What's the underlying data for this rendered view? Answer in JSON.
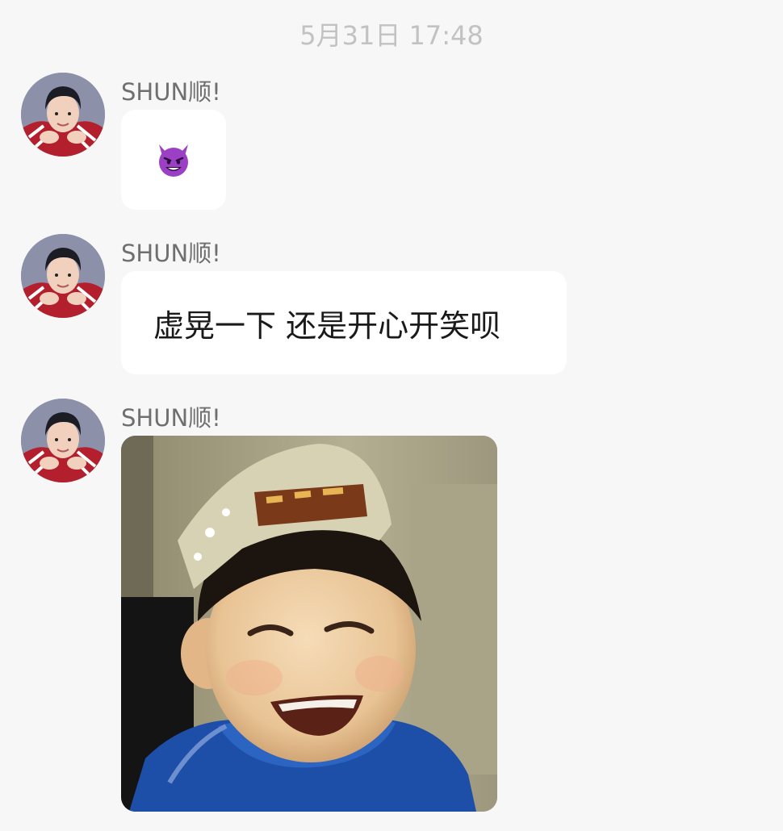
{
  "chat": {
    "timestamp": "5月31日 17:48",
    "messages": [
      {
        "sender": "SHUN顺!",
        "type": "emoji",
        "emoji_icon": "smiling-devil-emoji"
      },
      {
        "sender": "SHUN顺!",
        "type": "text",
        "text": "虚晃一下 还是开心开笑呗"
      },
      {
        "sender": "SHUN顺!",
        "type": "image",
        "image_icon": "laughing-child-crown-photo"
      }
    ]
  },
  "colors": {
    "background": "#f7f7f7",
    "bubble": "#ffffff",
    "timestamp_text": "#c2c2c2",
    "sender_text": "#6f6f6f",
    "message_text": "#1a1a1a",
    "emoji_purple": "#9b3fc4"
  }
}
